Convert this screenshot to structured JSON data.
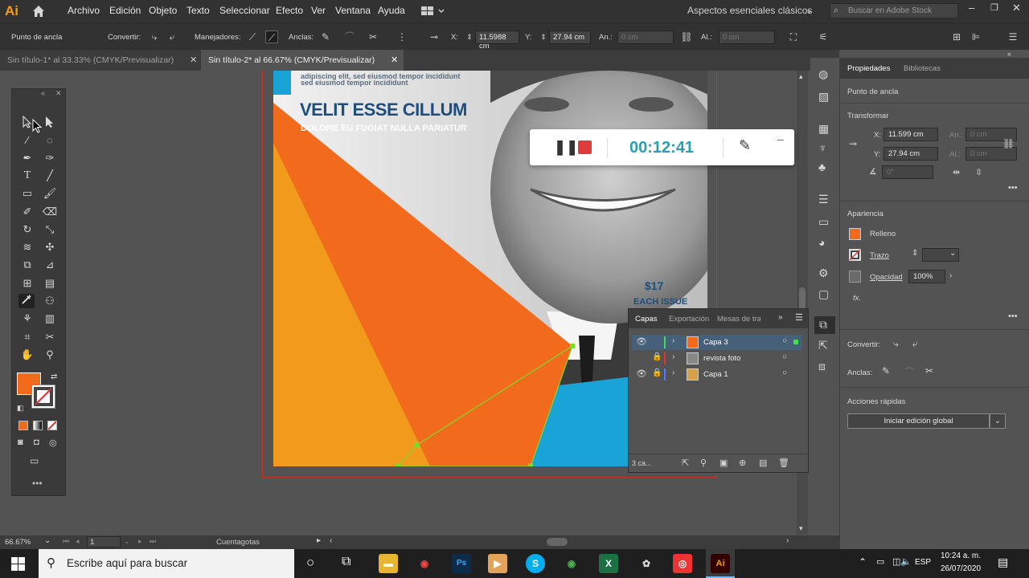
{
  "app": {
    "logo": "Ai"
  },
  "menu": [
    "Archivo",
    "Edición",
    "Objeto",
    "Texto",
    "Seleccionar",
    "Efecto",
    "Ver",
    "Ventana",
    "Ayuda"
  ],
  "workspace": "Aspectos esenciales clásicos",
  "search": {
    "placeholder": "Buscar en Adobe Stock"
  },
  "control": {
    "mode_label": "Punto de ancla",
    "convert_label": "Convertir:",
    "handles_label": "Manejadores:",
    "anchors_label": "Anclas:",
    "x_label": "X:",
    "x_value": "11.5988 cm",
    "y_label": "Y:",
    "y_value": "27.94 cm",
    "w_label": "An.:",
    "w_value": "0 cm",
    "h_label": "Al.:",
    "h_value": "0 cm"
  },
  "tabs": [
    {
      "label": "Sin título-1* al 33.33% (CMYK/Previsualizar)"
    },
    {
      "label": "Sin título-2* al 66.67% (CMYK/Previsualizar)"
    }
  ],
  "artwork": {
    "headline": "VELIT ESSE CILLUM",
    "subhead": "DOLORE EU FUGIAT NULLA PARIATUR",
    "blurb1": "adipiscing elit, sed eiusmod tempor incididunt",
    "blurb2": "sed eiusmod tempor incididunt",
    "price": "$17",
    "price_sub": "EACH ISSUE"
  },
  "timer": {
    "time": "00:12:41"
  },
  "layers": {
    "tabs": [
      "Capas",
      "Exportación",
      "Mesas de tra"
    ],
    "items": [
      {
        "name": "Capa 3",
        "color": "#3de24a",
        "selected": true
      },
      {
        "name": "revista foto",
        "color": "#e8332e",
        "selected": false
      },
      {
        "name": "Capa 1",
        "color": "#4f7cff",
        "selected": false
      }
    ],
    "footer": "3 ca..."
  },
  "properties": {
    "tabs": [
      "Propiedades",
      "Bibliotecas"
    ],
    "selection": "Punto de ancla",
    "transform_title": "Transformar",
    "x_label": "X:",
    "x_value": "11.599 cm",
    "y_label": "Y:",
    "y_value": "27.94 cm",
    "w_label": "An.:",
    "w_value": "0 cm",
    "h_label": "Al.:",
    "h_value": "0 cm",
    "angle_value": "0°",
    "appearance_title": "Apariencia",
    "fill_label": "Relleno",
    "stroke_label": "Trazo",
    "opacity_label": "Opacidad",
    "opacity_value": "100%",
    "fx_label": "fx.",
    "convert_label": "Convertir:",
    "anchors_label": "Anclas:",
    "quick_actions_title": "Acciones rápidas",
    "quick_action_button": "Iniciar edición global",
    "fill_color": "#f26a1b"
  },
  "status": {
    "zoom": "66.67%",
    "artboard": "1",
    "tool": "Cuentagotas"
  },
  "taskbar": {
    "search_placeholder": "Escribe aquí para buscar",
    "lang": "ESP",
    "time": "10:24 a. m.",
    "date": "26/07/2020"
  },
  "colors": {
    "orange": "#f26a1b",
    "orange_light": "#f29a1b",
    "cyan": "#1aa3d6",
    "timer_teal": "#2a9fb0",
    "record_red": "#e03b3b"
  }
}
